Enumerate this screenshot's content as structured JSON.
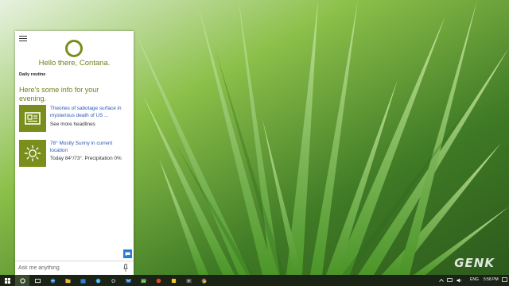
{
  "cortana": {
    "greeting": "Hello there, Contana.",
    "section_label": "Daily routine",
    "info_title": "Here's some info for your evening.",
    "cards": [
      {
        "icon": "news-icon",
        "headline": "Theories of sabotage surface in mysterious death of US ...",
        "sub": "See more headlines"
      },
      {
        "icon": "sun-icon",
        "headline": "78° Mostly Sunny in current location",
        "sub": "Today 84°/73°. Precipitation 0%"
      }
    ],
    "search": {
      "placeholder": "Ask me anything"
    },
    "accent": "#7a8e1c"
  },
  "taskbar": {
    "language": "ENG",
    "time": "5:58 PM",
    "apps": [
      "start-icon",
      "cortana-icon",
      "task-view-icon",
      "edge-icon",
      "explorer-icon",
      "store-icon",
      "skype-icon",
      "settings-icon",
      "mail-icon",
      "photos-icon",
      "media-icon",
      "chrome-icon"
    ]
  },
  "watermark": "GENK"
}
